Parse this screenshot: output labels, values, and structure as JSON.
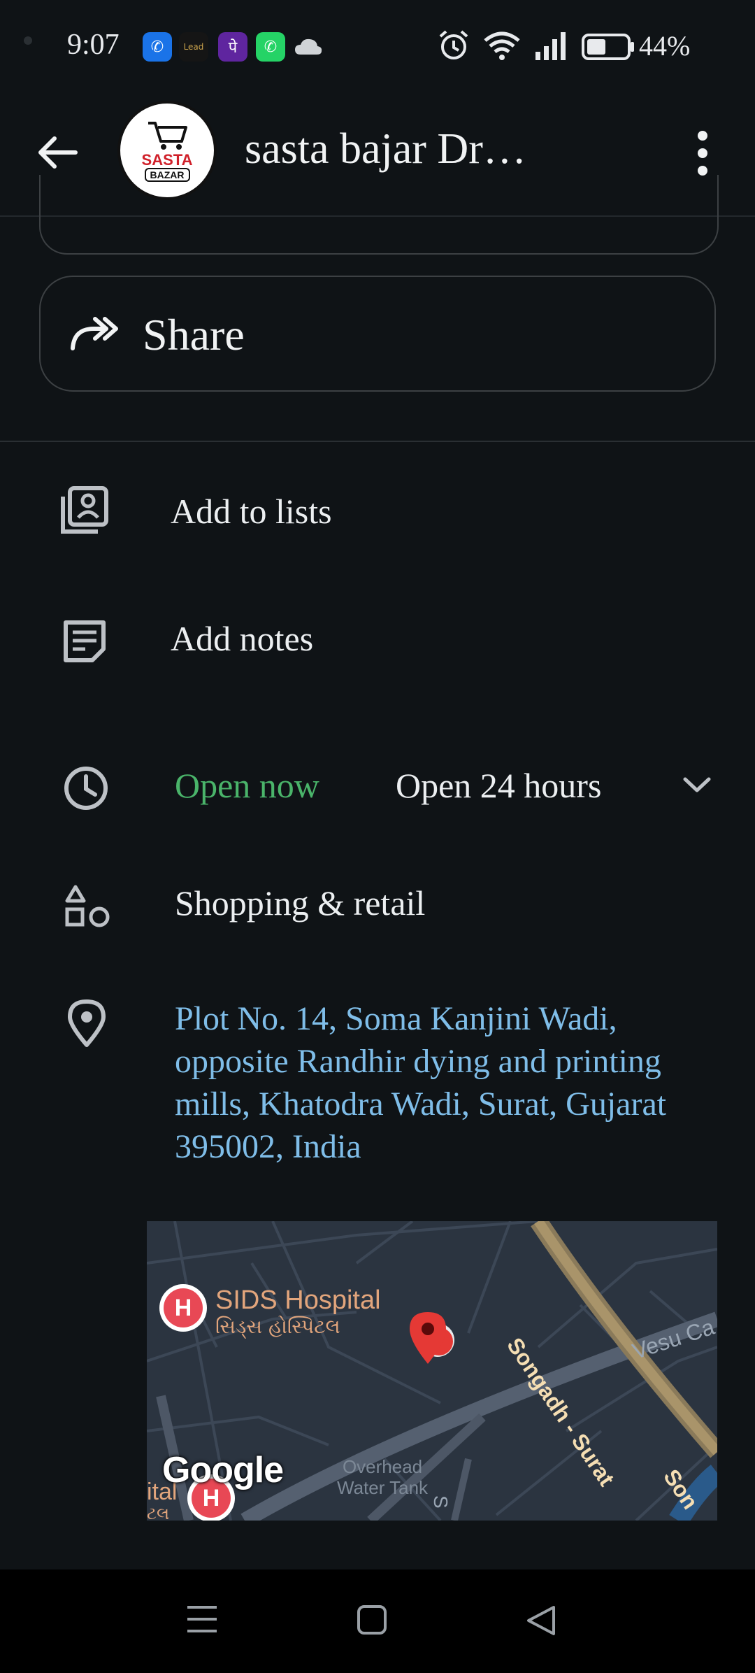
{
  "status_bar": {
    "time": "9:07",
    "battery": "44%",
    "notification_icons": [
      "phone-app-icon",
      "leader-app-icon",
      "phonepe-icon",
      "whatsapp-icon",
      "cloud-icon"
    ],
    "status_icons": [
      "alarm-icon",
      "wifi-icon",
      "signal-icon",
      "battery-icon"
    ]
  },
  "header": {
    "title": "sasta bajar Dr…",
    "logo_line1": "SASTA",
    "logo_line2": "BAZAR",
    "back_icon": "arrow-left-icon",
    "menu_icon": "more-vert-icon"
  },
  "actions": {
    "share_label": "Share"
  },
  "list": {
    "add_to_lists": "Add to lists",
    "add_notes": "Add notes",
    "open_status": "Open now",
    "hours": "Open 24 hours",
    "category": "Shopping & retail",
    "address": "Plot No. 14, Soma Kanjini Wadi, opposite Randhir dying and printing mills, Khatodra Wadi, Surat, Gujarat 395002, India"
  },
  "map": {
    "poi1_name": "SIDS Hospital",
    "poi1_local": "સિડ્સ હોસ્પિટલ",
    "road1": "Songadh - Surat",
    "road1_tail": "Son",
    "road2": "Vesu Ca",
    "landmark1": "Overhead",
    "landmark2": "Water Tank",
    "edge_text1": "ital",
    "edge_text2": "ટલ",
    "road3": "S",
    "logo": "Google",
    "poi_letter": "H"
  },
  "colors": {
    "background": "#0f1316",
    "open_green": "#4ab46a",
    "address_blue": "#7fbde8",
    "poi_red": "#e84855",
    "pin_red": "#e53935"
  }
}
